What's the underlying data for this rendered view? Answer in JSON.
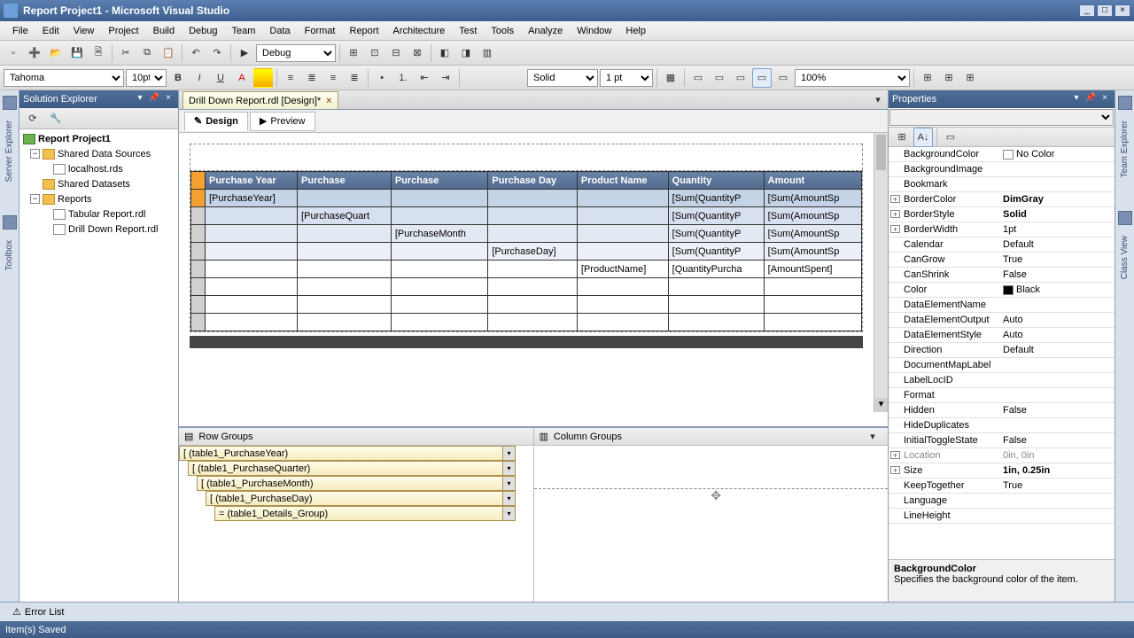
{
  "title": "Report Project1 - Microsoft Visual Studio",
  "menu": [
    "File",
    "Edit",
    "View",
    "Project",
    "Build",
    "Debug",
    "Team",
    "Data",
    "Format",
    "Report",
    "Architecture",
    "Test",
    "Tools",
    "Analyze",
    "Window",
    "Help"
  ],
  "toolbar1": {
    "config": "Debug"
  },
  "toolbar2": {
    "font": "Tahoma",
    "size": "10pt",
    "borderStyle": "Solid",
    "borderWidth": "1 pt",
    "zoom": "100%"
  },
  "solExplorer": {
    "title": "Solution Explorer",
    "project": "Report Project1",
    "nodes": [
      {
        "label": "Shared Data Sources",
        "children": [
          {
            "label": "localhost.rds"
          }
        ]
      },
      {
        "label": "Shared Datasets"
      },
      {
        "label": "Reports",
        "children": [
          {
            "label": "Tabular Report.rdl"
          },
          {
            "label": "Drill Down Report.rdl"
          }
        ]
      }
    ]
  },
  "docTab": "Drill Down Report.rdl [Design]*",
  "viewTabs": {
    "design": "Design",
    "preview": "Preview"
  },
  "tablix": {
    "headers": [
      "Purchase Year",
      "Purchase",
      "Purchase",
      "Purchase Day",
      "Product Name",
      "Quantity",
      "Amount"
    ],
    "rows": [
      {
        "cls": "grp",
        "cells": [
          "[PurchaseYear]",
          "",
          "",
          "",
          "",
          "[Sum(QuantityP",
          "[Sum(AmountSp"
        ]
      },
      {
        "cls": "grp2",
        "cells": [
          "",
          "[PurchaseQuart",
          "",
          "",
          "",
          "[Sum(QuantityP",
          "[Sum(AmountSp"
        ]
      },
      {
        "cls": "grp3",
        "cells": [
          "",
          "",
          "[PurchaseMonth",
          "",
          "",
          "[Sum(QuantityP",
          "[Sum(AmountSp"
        ]
      },
      {
        "cls": "grp4",
        "cells": [
          "",
          "",
          "",
          "[PurchaseDay]",
          "",
          "[Sum(QuantityP",
          "[Sum(AmountSp"
        ]
      },
      {
        "cls": "det",
        "cells": [
          "",
          "",
          "",
          "",
          "[ProductName]",
          "[QuantityPurcha",
          "[AmountSpent]"
        ]
      },
      {
        "cls": "det",
        "cells": [
          "",
          "",
          "",
          "",
          "",
          "",
          ""
        ]
      },
      {
        "cls": "det",
        "cells": [
          "",
          "",
          "",
          "",
          "",
          "",
          ""
        ]
      },
      {
        "cls": "det",
        "cells": [
          "",
          "",
          "",
          "",
          "",
          "",
          ""
        ]
      }
    ]
  },
  "groups": {
    "rowLabel": "Row Groups",
    "colLabel": "Column Groups",
    "rowGroups": [
      "[ (table1_PurchaseYear)",
      "[ (table1_PurchaseQuarter)",
      "[ (table1_PurchaseMonth)",
      "[ (table1_PurchaseDay)",
      "= (table1_Details_Group)"
    ]
  },
  "properties": {
    "title": "Properties",
    "rows": [
      {
        "exp": " ",
        "name": "BackgroundColor",
        "val": "No Color",
        "swatch": "#ffffff"
      },
      {
        "exp": " ",
        "name": "BackgroundImage",
        "val": ""
      },
      {
        "exp": " ",
        "name": "Bookmark",
        "val": ""
      },
      {
        "exp": "+",
        "name": "BorderColor",
        "val": "DimGray",
        "bold": true
      },
      {
        "exp": "+",
        "name": "BorderStyle",
        "val": "Solid",
        "bold": true
      },
      {
        "exp": "+",
        "name": "BorderWidth",
        "val": "1pt"
      },
      {
        "exp": " ",
        "name": "Calendar",
        "val": "Default"
      },
      {
        "exp": " ",
        "name": "CanGrow",
        "val": "True"
      },
      {
        "exp": " ",
        "name": "CanShrink",
        "val": "False"
      },
      {
        "exp": " ",
        "name": "Color",
        "val": "Black",
        "swatch": "#000000"
      },
      {
        "exp": " ",
        "name": "DataElementName",
        "val": ""
      },
      {
        "exp": " ",
        "name": "DataElementOutput",
        "val": "Auto"
      },
      {
        "exp": " ",
        "name": "DataElementStyle",
        "val": "Auto"
      },
      {
        "exp": " ",
        "name": "Direction",
        "val": "Default"
      },
      {
        "exp": " ",
        "name": "DocumentMapLabel",
        "val": ""
      },
      {
        "exp": " ",
        "name": "LabelLocID",
        "val": ""
      },
      {
        "exp": " ",
        "name": "Format",
        "val": ""
      },
      {
        "exp": " ",
        "name": "Hidden",
        "val": "False"
      },
      {
        "exp": " ",
        "name": "HideDuplicates",
        "val": ""
      },
      {
        "exp": " ",
        "name": "InitialToggleState",
        "val": "False"
      },
      {
        "exp": "+",
        "name": "Location",
        "val": "0in, 0in",
        "dim": true
      },
      {
        "exp": "+",
        "name": "Size",
        "val": "1in, 0.25in",
        "bold": true
      },
      {
        "exp": " ",
        "name": "KeepTogether",
        "val": "True"
      },
      {
        "exp": " ",
        "name": "Language",
        "val": ""
      },
      {
        "exp": " ",
        "name": "LineHeight",
        "val": ""
      }
    ],
    "descTitle": "BackgroundColor",
    "descText": "Specifies the background color of the item."
  },
  "bottom": {
    "errorList": "Error List"
  },
  "status": "Item(s) Saved",
  "leftRail": {
    "label1": "Server Explorer",
    "label2": "Toolbox"
  },
  "rightRail": {
    "label1": "Team Explorer",
    "label2": "Class View"
  }
}
